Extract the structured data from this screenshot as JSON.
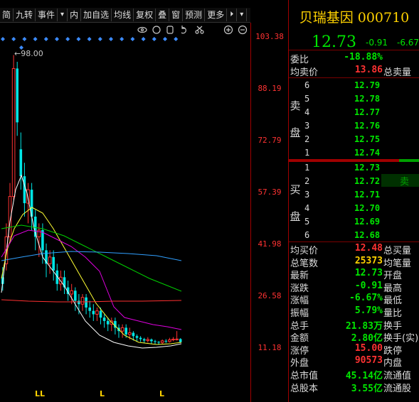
{
  "toolbar": {
    "items": [
      "简",
      "九转",
      "事件",
      "▾",
      "内",
      "加自选",
      "均线",
      "复权",
      "叠",
      "窗",
      "预测",
      "更多",
      "⏵",
      "▾"
    ]
  },
  "chart": {
    "price_ticks": [
      "103.38",
      "88.19",
      "72.79",
      "57.39",
      "41.98",
      "26.58",
      "11.18"
    ],
    "high_label": "98.00",
    "date_markers": [
      "LL",
      "L",
      "L"
    ],
    "tool_icons": [
      "eye-icon",
      "circle-icon",
      "hand-icon",
      "undo-icon",
      "scissors-icon",
      "zoom-in-icon",
      "zoom-out-icon"
    ]
  },
  "stock": {
    "title": "贝瑞基因 000710",
    "price": "12.73",
    "change": "-0.91",
    "change_pct": "-6.67%"
  },
  "committee": {
    "label": "委比",
    "value": "-18.88%"
  },
  "avg_sell": {
    "label": "均卖价",
    "value": "13.86",
    "label2": "总卖量"
  },
  "asks": {
    "side_label": [
      "卖",
      "盘"
    ],
    "levels": [
      {
        "lvl": "6",
        "price": "12.79"
      },
      {
        "lvl": "5",
        "price": "12.78"
      },
      {
        "lvl": "4",
        "price": "12.77"
      },
      {
        "lvl": "3",
        "price": "12.76"
      },
      {
        "lvl": "2",
        "price": "12.75"
      },
      {
        "lvl": "1",
        "price": "12.74"
      }
    ]
  },
  "bids": {
    "side_label": [
      "买",
      "盘"
    ],
    "sell_tag": "卖",
    "levels": [
      {
        "lvl": "1",
        "price": "12.73"
      },
      {
        "lvl": "2",
        "price": "12.72"
      },
      {
        "lvl": "3",
        "price": "12.71"
      },
      {
        "lvl": "4",
        "price": "12.70"
      },
      {
        "lvl": "5",
        "price": "12.69"
      },
      {
        "lvl": "6",
        "price": "12.68"
      }
    ]
  },
  "stats": [
    {
      "label": "均买价",
      "value": "12.48",
      "label2": "总买量",
      "color": "#ff3232"
    },
    {
      "label": "总笔数",
      "value": "25373",
      "label2": "均笔量",
      "color": "#ffd200"
    },
    {
      "label": "最新",
      "value": "12.73",
      "label2": "开盘",
      "color": "#00e600"
    },
    {
      "label": "涨跌",
      "value": "-0.91",
      "label2": "最高",
      "color": "#00e600"
    },
    {
      "label": "涨幅",
      "value": "-6.67%",
      "label2": "最低",
      "color": "#00e600"
    },
    {
      "label": "振幅",
      "value": "5.79%",
      "label2": "量比",
      "color": "#00e600"
    },
    {
      "label": "总手",
      "value": "21.83万",
      "label2": "换手",
      "color": "#00e600"
    },
    {
      "label": "金额",
      "value": "2.80亿",
      "label2": "换手(实)",
      "color": "#00e600"
    },
    {
      "label": "涨停",
      "value": "15.00",
      "label2": "跌停",
      "color": "#ff3232"
    },
    {
      "label": "外盘",
      "value": "90573",
      "label2": "内盘",
      "color": "#ff3232"
    },
    {
      "label": "总市值",
      "value": "45.14亿",
      "label2": "流通值",
      "color": "#00e600"
    },
    {
      "label": "总股本",
      "value": "3.55亿",
      "label2": "流通股",
      "color": "#00e600"
    }
  ],
  "colors": {
    "up": "#ff3232",
    "down": "#00e6e6",
    "green": "#00e600",
    "yellow": "#ffd200"
  }
}
